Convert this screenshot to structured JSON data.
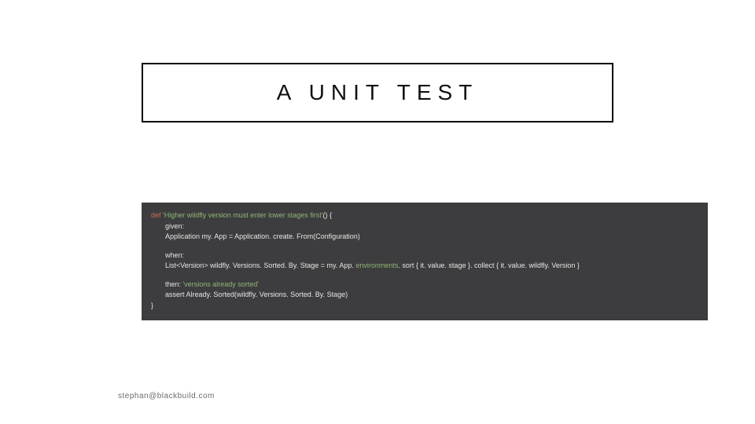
{
  "title": "A UNIT TEST",
  "code": {
    "def_keyword": "def ",
    "def_name": "'Higher wildfly version must enter lower stages first'",
    "def_suffix": "() {",
    "given_label": "given:",
    "given_line": "Application my. App = Application. create. From(Configuration)",
    "when_label": "when:",
    "when_prefix": "List<Version> wildfly. Versions. Sorted. By. Stage = my. App. ",
    "when_env": "environments",
    "when_suffix": ". sort { it. value. stage }. collect { it. value. wildfly. Version }",
    "then_label": "then: ",
    "then_str": "'versions already sorted'",
    "then_line": "assert Already. Sorted(wildfly. Versions. Sorted. By. Stage)",
    "close": "}"
  },
  "footer": "stephan@blackbuild.com"
}
